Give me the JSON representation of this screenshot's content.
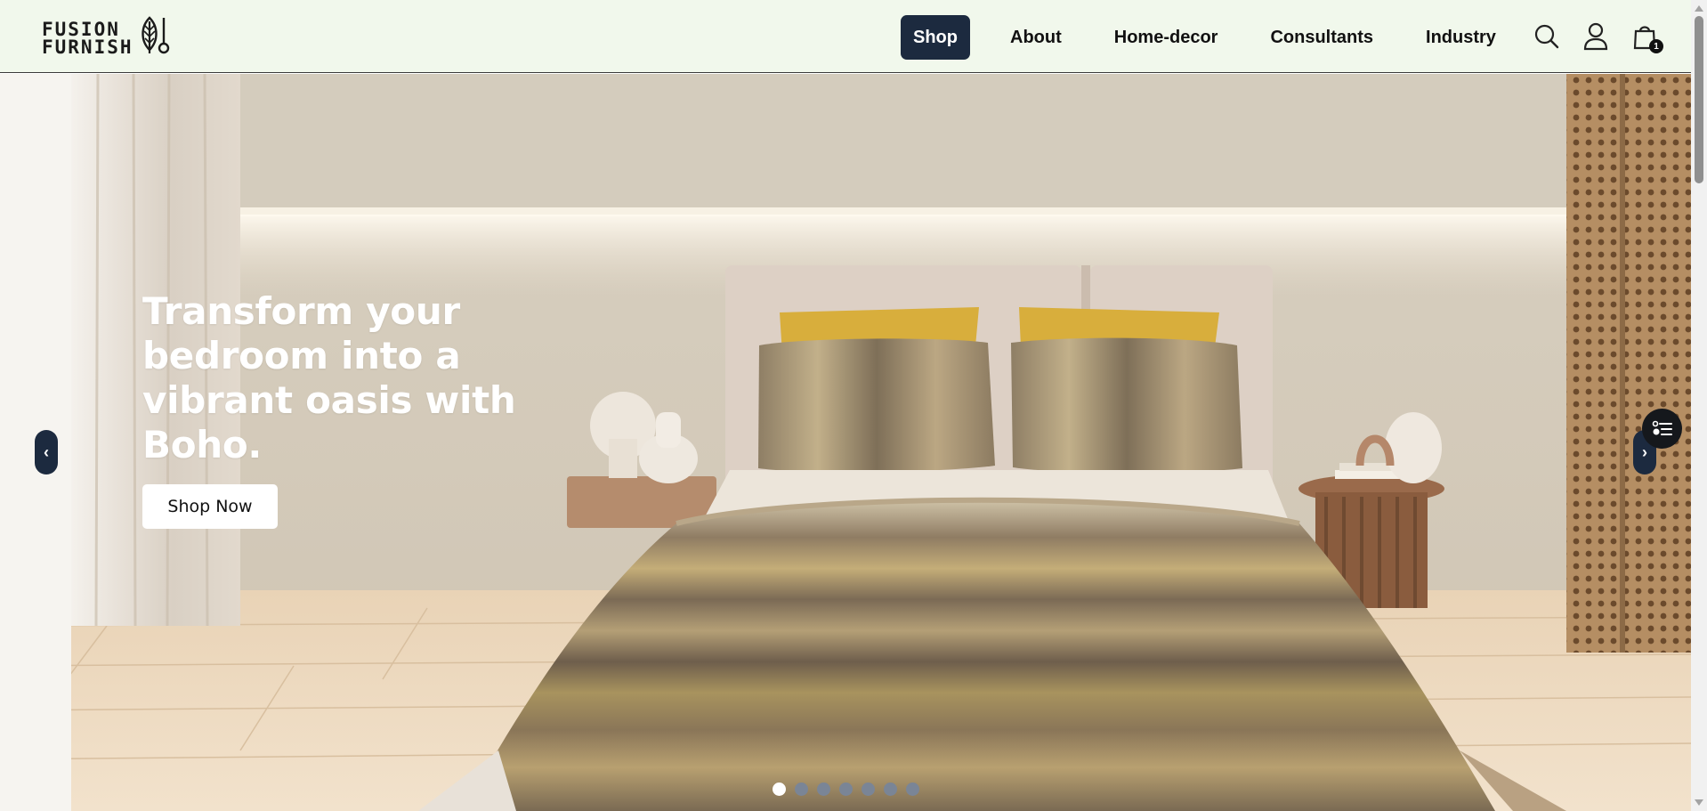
{
  "brand": {
    "line1": "FUSION",
    "line2": "FURNISH",
    "logo_icon": "leaf-icon"
  },
  "nav": {
    "items": [
      {
        "label": "Shop",
        "active": true
      },
      {
        "label": "About",
        "active": false
      },
      {
        "label": "Home-decor",
        "active": false
      },
      {
        "label": "Consultants",
        "active": false
      },
      {
        "label": "Industry",
        "active": false
      }
    ]
  },
  "header_icons": {
    "search": "search-icon",
    "account": "user-icon",
    "cart": "shopping-bag-icon",
    "cart_count": "1"
  },
  "hero": {
    "title": "Transform your bedroom into a vibrant oasis with Boho.",
    "cta": "Shop Now",
    "prev_label": "‹",
    "next_label": "›",
    "slides_total": 7,
    "active_slide": 1
  },
  "colors": {
    "header_bg": "#f1f8ec",
    "accent": "#1c2a3f",
    "dot_inactive": "#7a8596",
    "dot_active": "#ffffff"
  }
}
